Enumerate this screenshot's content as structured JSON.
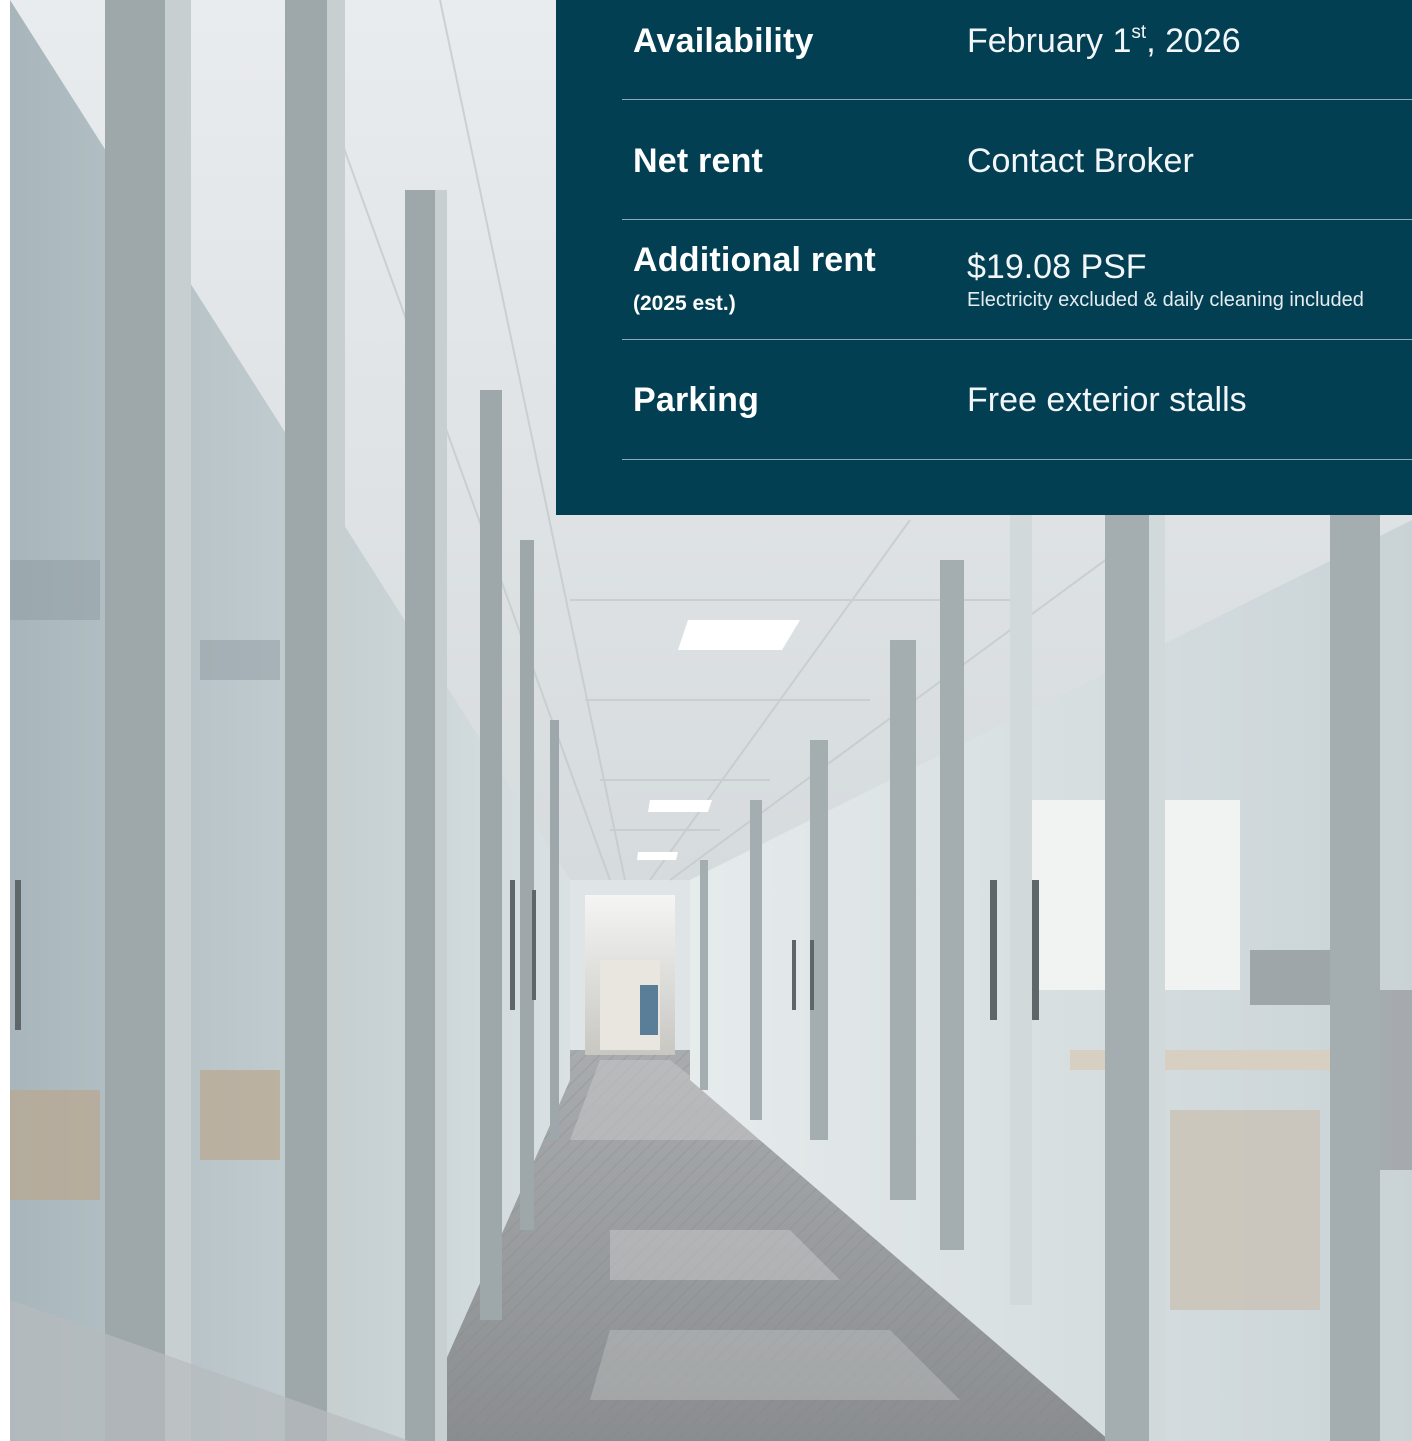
{
  "details": {
    "rows": [
      {
        "label": "Availability",
        "value_main": "February 1",
        "value_sup": "st",
        "value_tail": ", 2026"
      },
      {
        "label": "Net rent",
        "value": "Contact Broker"
      },
      {
        "label": "Additional rent",
        "sublabel": "(2025 est.)",
        "value": "$19.08 PSF",
        "note": "Electricity excluded & daily cleaning included"
      },
      {
        "label": "Parking",
        "value": "Free exterior stalls"
      }
    ]
  },
  "colors": {
    "panel_background": "#033f52",
    "panel_text": "#ffffff",
    "divider": "#8aa3ad"
  },
  "photo": {
    "subject": "office-corridor-glass-walls"
  }
}
